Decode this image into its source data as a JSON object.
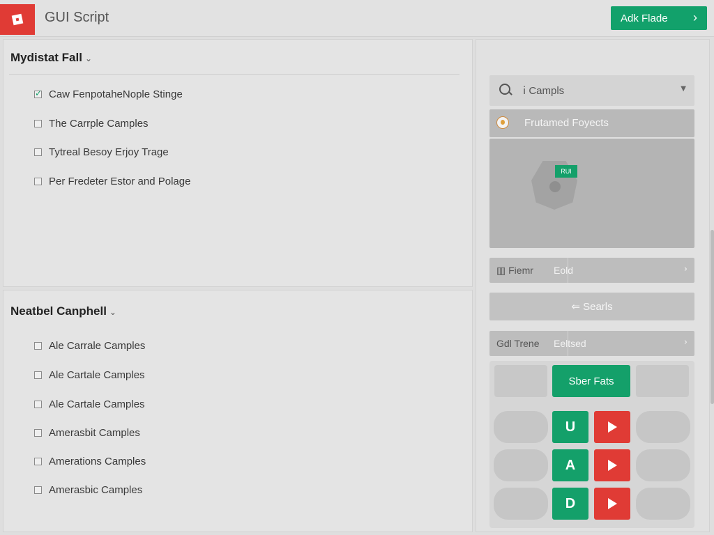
{
  "window": {
    "title": "GUI Script"
  },
  "top_button": {
    "label": "Adk Flade",
    "chevron": "›"
  },
  "section1": {
    "title": "Mydistat Fall",
    "caret": "⌄",
    "items": [
      {
        "label": "Caw FenpotaheNople Stinge",
        "checked": true
      },
      {
        "label": "The Carrple Camples",
        "checked": false
      },
      {
        "label": "Tytreal Besoy Erjoy Trage",
        "checked": false
      },
      {
        "label": "Per Fredeter Estor and Polage",
        "checked": false
      }
    ]
  },
  "section2": {
    "title": "Neatbel Canphell",
    "caret": "⌄",
    "items": [
      {
        "label": "Ale Carrale Camples",
        "checked": false
      },
      {
        "label": "Ale Cartale Camples",
        "checked": false
      },
      {
        "label": "Ale Cartale Camples",
        "checked": false
      },
      {
        "label": "Amerasbit Camples",
        "checked": false
      },
      {
        "label": "Amerations Camples",
        "checked": false
      },
      {
        "label": "Amerasbic Camples",
        "checked": false
      }
    ]
  },
  "right": {
    "search": {
      "value": "ⅰ Campls",
      "icon": "search-icon"
    },
    "featured": {
      "label": "Frutamed Foyects",
      "icon": "emblem-icon"
    },
    "preview": {
      "tag": "RUI"
    },
    "field1": {
      "label": "▥ Fiemr",
      "value": "Eold",
      "chevron": "›"
    },
    "search_button": {
      "label": "⇐ Searls"
    },
    "field2": {
      "label": "Gdl Trene",
      "value": "Eeltsed",
      "chevron": "›"
    },
    "sheet_button": {
      "label": "Sber Fats"
    },
    "keys": [
      {
        "letter": "U"
      },
      {
        "letter": "A"
      },
      {
        "letter": "D"
      }
    ]
  },
  "colors": {
    "accent": "#14a06a",
    "danger": "#e03b35",
    "panel": "#e4e4e4"
  }
}
